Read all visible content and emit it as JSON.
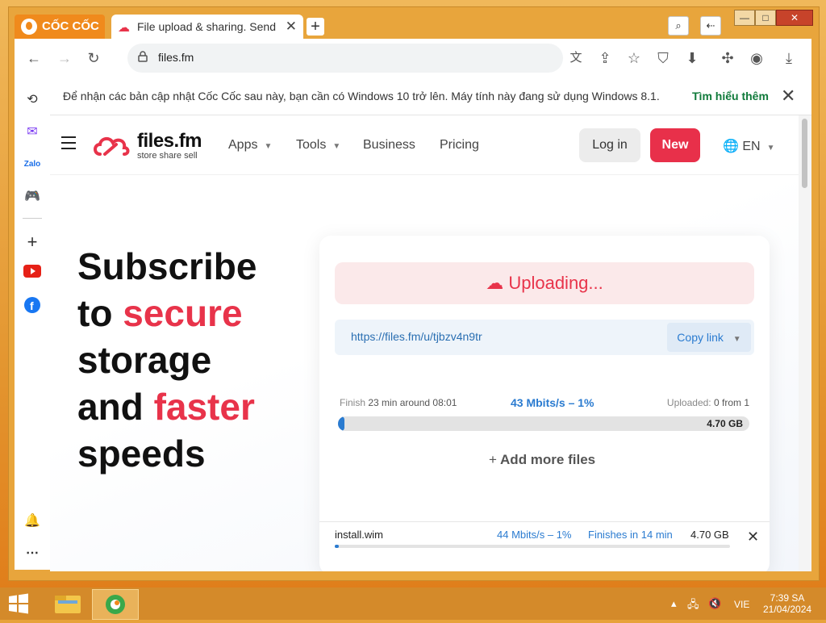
{
  "browser": {
    "brand_label": "CỐC CỐC",
    "tab_title": "File upload & sharing. Send",
    "url": "files.fm",
    "notification": {
      "message": "Để nhận các bản cập nhật Cốc Cốc sau này, bạn cần có Windows 10 trở lên. Máy tính này đang sử dụng Windows 8.1.",
      "learn_more": "Tìm hiểu thêm"
    }
  },
  "site": {
    "logo_text": "files.fm",
    "logo_tagline": "store share sell",
    "nav": [
      {
        "label": "Apps"
      },
      {
        "label": "Tools"
      },
      {
        "label": "Business"
      },
      {
        "label": "Pricing"
      }
    ],
    "login_label": "Log in",
    "new_label": "New",
    "lang_label": "EN"
  },
  "hero": {
    "line1": "Subscribe",
    "line2_plain": "to",
    "line2_red": "secure",
    "line3": "storage",
    "line4_plain": "and",
    "line4_red": "faster",
    "line5": "speeds"
  },
  "upload": {
    "status_label": "Uploading...",
    "share_link": "https://files.fm/u/tjbzv4n9tr",
    "copy_label": "Copy link",
    "finish_label": "Finish",
    "finish_value": "23 min around 08:01",
    "speed_label": "43 Mbits/s – 1%",
    "uploaded_label": "Uploaded:",
    "uploaded_value": "0 from 1",
    "total_size": "4.70 GB",
    "progress": 0.01,
    "add_more_label": "Add more files",
    "file": {
      "name": "install.wim",
      "speed": "44 Mbits/s – 1%",
      "finishes": "Finishes in 14 min",
      "size": "4.70 GB",
      "progress": 0.01
    }
  },
  "taskbar": {
    "language": "VIE",
    "time": "7:39 SA",
    "date": "21/04/2024"
  },
  "colors": {
    "accent_red": "#e8334a",
    "link_blue": "#2a7bd0",
    "coccoc_orange": "#f08a1c"
  }
}
